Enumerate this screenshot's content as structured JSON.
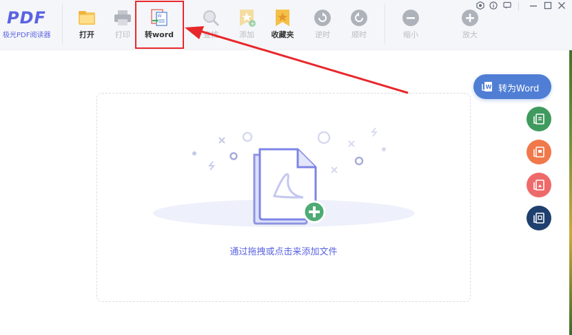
{
  "app": {
    "logo_text": "PDF",
    "logo_subtitle": "极光PDF阅读器"
  },
  "toolbar": {
    "buttons": [
      {
        "id": "open",
        "label": "打开",
        "icon": "folder-icon",
        "enabled": true
      },
      {
        "id": "print",
        "label": "打印",
        "icon": "printer-icon",
        "enabled": false
      },
      {
        "id": "to_word",
        "label": "转word",
        "icon": "word-convert-icon",
        "enabled": true
      },
      {
        "id": "search",
        "label": "查找",
        "icon": "magnifier-icon",
        "enabled": false
      },
      {
        "id": "add",
        "label": "添加",
        "icon": "star-add-icon",
        "enabled": false
      },
      {
        "id": "favorites",
        "label": "收藏夹",
        "icon": "star-folder-icon",
        "enabled": true
      },
      {
        "id": "rotate_ccw",
        "label": "逆时",
        "icon": "rotate-ccw-icon",
        "enabled": false
      },
      {
        "id": "rotate_cw",
        "label": "顺时",
        "icon": "rotate-cw-icon",
        "enabled": false
      },
      {
        "id": "zoom_out",
        "label": "缩小",
        "icon": "zoom-out-icon",
        "enabled": false
      },
      {
        "id": "zoom_in",
        "label": "放大",
        "icon": "zoom-in-icon",
        "enabled": false
      }
    ]
  },
  "window_controls": [
    "settings-icon",
    "info-icon",
    "feedback-icon",
    "minimize-icon",
    "maximize-icon",
    "close-icon"
  ],
  "main": {
    "drop_hint": "通过拖拽或点击来添加文件"
  },
  "side_actions": {
    "convert_label": "转为Word",
    "fabs": [
      {
        "id": "to_excel",
        "color": "#3f9a5e",
        "icon": "excel-convert-icon"
      },
      {
        "id": "to_ppt",
        "color": "#f0784a",
        "icon": "ppt-convert-icon"
      },
      {
        "id": "to_image",
        "color": "#ee6a6a",
        "icon": "image-convert-icon"
      },
      {
        "id": "to_other",
        "color": "#1f3f6e",
        "icon": "pdf-convert-icon"
      }
    ]
  },
  "colors": {
    "accent": "#5a63e0",
    "convert_button": "#4f7ed4",
    "highlight_annotation": "#e8272a"
  }
}
